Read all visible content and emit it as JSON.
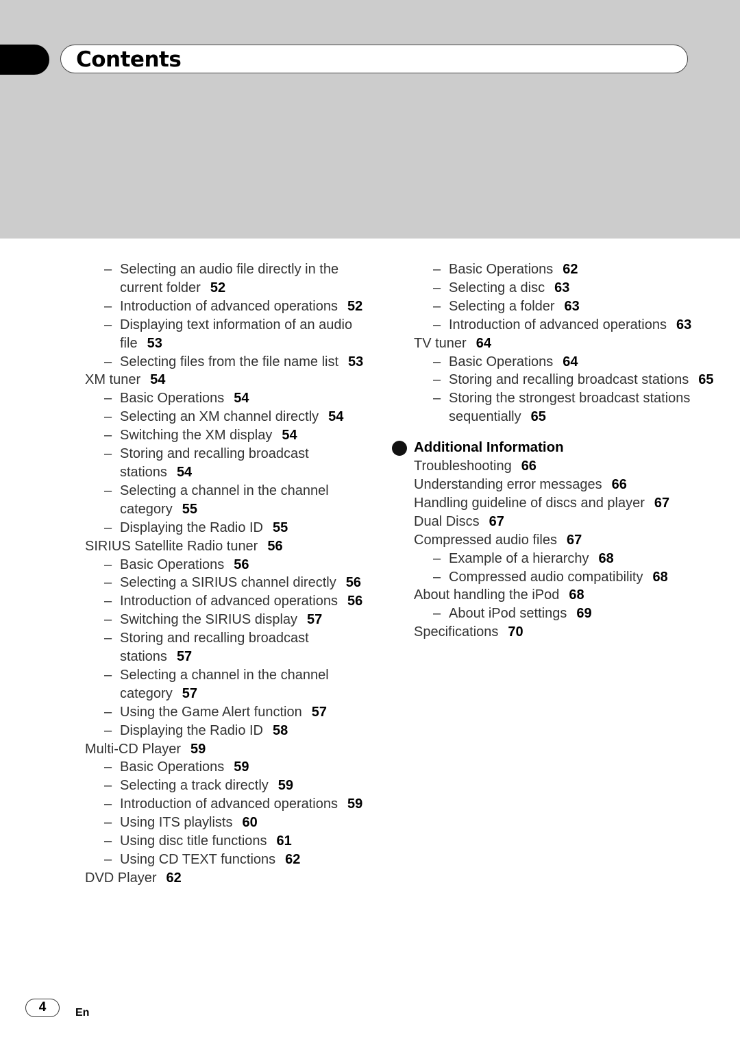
{
  "header": {
    "title": "Contents"
  },
  "left_column": [
    {
      "level": 2,
      "text": "Selecting an audio file directly in the current folder",
      "page": "52"
    },
    {
      "level": 2,
      "text": "Introduction of advanced operations",
      "page": "52"
    },
    {
      "level": 2,
      "text": "Displaying text information of an audio file",
      "page": "53"
    },
    {
      "level": 2,
      "text": "Selecting files from the file name list",
      "page": "53"
    },
    {
      "level": 1,
      "text": "XM tuner",
      "page": "54"
    },
    {
      "level": 2,
      "text": "Basic Operations",
      "page": "54"
    },
    {
      "level": 2,
      "text": "Selecting an XM channel directly",
      "page": "54"
    },
    {
      "level": 2,
      "text": "Switching the XM display",
      "page": "54"
    },
    {
      "level": 2,
      "text": "Storing and recalling broadcast stations",
      "page": "54"
    },
    {
      "level": 2,
      "text": "Selecting a channel in the channel category",
      "page": "55"
    },
    {
      "level": 2,
      "text": "Displaying the Radio ID",
      "page": "55"
    },
    {
      "level": 1,
      "text": "SIRIUS Satellite Radio tuner",
      "page": "56"
    },
    {
      "level": 2,
      "text": "Basic Operations",
      "page": "56"
    },
    {
      "level": 2,
      "text": "Selecting a SIRIUS channel directly",
      "page": "56"
    },
    {
      "level": 2,
      "text": "Introduction of advanced operations",
      "page": "56"
    },
    {
      "level": 2,
      "text": "Switching the SIRIUS display",
      "page": "57"
    },
    {
      "level": 2,
      "text": "Storing and recalling broadcast stations",
      "page": "57"
    },
    {
      "level": 2,
      "text": "Selecting a channel in the channel category",
      "page": "57"
    },
    {
      "level": 2,
      "text": "Using the Game Alert function",
      "page": "57"
    },
    {
      "level": 2,
      "text": "Displaying the Radio ID",
      "page": "58"
    },
    {
      "level": 1,
      "text": "Multi-CD Player",
      "page": "59"
    },
    {
      "level": 2,
      "text": "Basic Operations",
      "page": "59"
    },
    {
      "level": 2,
      "text": "Selecting a track directly",
      "page": "59"
    },
    {
      "level": 2,
      "text": "Introduction of advanced operations",
      "page": "59"
    },
    {
      "level": 2,
      "text": "Using ITS playlists",
      "page": "60"
    },
    {
      "level": 2,
      "text": "Using disc title functions",
      "page": "61"
    },
    {
      "level": 2,
      "text": "Using CD TEXT functions",
      "page": "62"
    },
    {
      "level": 1,
      "text": "DVD Player",
      "page": "62"
    }
  ],
  "right_column": [
    {
      "level": 2,
      "text": "Basic Operations",
      "page": "62"
    },
    {
      "level": 2,
      "text": "Selecting a disc",
      "page": "63"
    },
    {
      "level": 2,
      "text": "Selecting a folder",
      "page": "63"
    },
    {
      "level": 2,
      "text": "Introduction of advanced operations",
      "page": "63"
    },
    {
      "level": 1,
      "text": "TV tuner",
      "page": "64"
    },
    {
      "level": 2,
      "text": "Basic Operations",
      "page": "64"
    },
    {
      "level": 2,
      "text": "Storing and recalling broadcast stations",
      "page": "65"
    },
    {
      "level": 2,
      "text": "Storing the strongest broadcast stations sequentially",
      "page": "65"
    }
  ],
  "section": {
    "title": "Additional Information",
    "items": [
      {
        "level": 1,
        "text": "Troubleshooting",
        "page": "66"
      },
      {
        "level": 1,
        "text": "Understanding error messages",
        "page": "66"
      },
      {
        "level": 1,
        "text": "Handling guideline of discs and player",
        "page": "67"
      },
      {
        "level": 1,
        "text": "Dual Discs",
        "page": "67"
      },
      {
        "level": 1,
        "text": "Compressed audio files",
        "page": "67"
      },
      {
        "level": 2,
        "text": "Example of a hierarchy",
        "page": "68"
      },
      {
        "level": 2,
        "text": "Compressed audio compatibility",
        "page": "68"
      },
      {
        "level": 1,
        "text": "About handling the iPod",
        "page": "68"
      },
      {
        "level": 2,
        "text": "About iPod settings",
        "page": "69"
      },
      {
        "level": 1,
        "text": "Specifications",
        "page": "70"
      }
    ]
  },
  "footer": {
    "page_number": "4",
    "language": "En"
  },
  "dash": "–"
}
